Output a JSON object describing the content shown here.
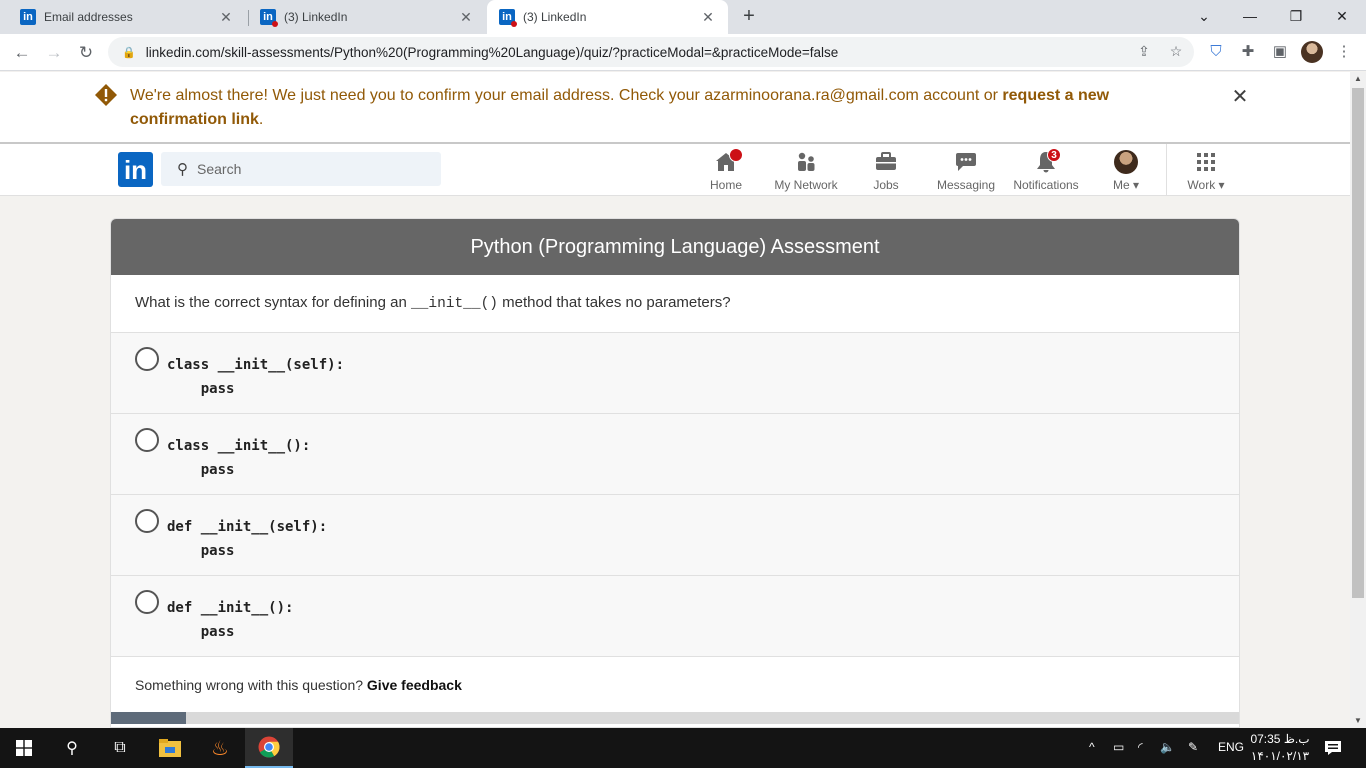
{
  "browser": {
    "tabs": [
      {
        "label": "Email addresses",
        "favicon": "linkedin-icon"
      },
      {
        "label": "(3) LinkedIn",
        "favicon": "linkedin-icon"
      },
      {
        "label": "(3) LinkedIn",
        "favicon": "linkedin-icon",
        "active": true
      }
    ],
    "url": "linkedin.com/skill-assessments/Python%20(Programming%20Language)/quiz/?practiceModal=&practiceMode=false"
  },
  "banner": {
    "message": "We're almost there! We just need you to confirm your email address. Check your azarminoorana.ra@gmail.com account or ",
    "link": "request a new confirmation link",
    "suffix": "."
  },
  "nav": {
    "logo": "in",
    "search_placeholder": "Search",
    "items": [
      {
        "label": "Home",
        "icon": "home-icon",
        "badge": ""
      },
      {
        "label": "My Network",
        "icon": "network-icon",
        "badge": ""
      },
      {
        "label": "Jobs",
        "icon": "briefcase-icon",
        "badge": ""
      },
      {
        "label": "Messaging",
        "icon": "chat-icon",
        "badge": ""
      },
      {
        "label": "Notifications",
        "icon": "bell-icon",
        "badge": "3"
      },
      {
        "label": "Me",
        "icon": "avatar",
        "badge": ""
      },
      {
        "label": "Work",
        "icon": "grid-icon",
        "badge": ""
      }
    ]
  },
  "assessment": {
    "title": "Python (Programming Language) Assessment",
    "question_prefix": "What is the correct syntax for defining an ",
    "question_code": "__init__()",
    "question_suffix": " method that takes no parameters?",
    "options": [
      "class __init__(self):\n    pass",
      "class __init__():\n    pass",
      "def __init__(self):\n    pass",
      "def __init__():\n    pass"
    ],
    "feedback_text": "Something wrong with this question? ",
    "feedback_link": "Give feedback",
    "progress": 0.066
  },
  "taskbar": {
    "language": "ENG",
    "time": "07:35 ب.ظ",
    "date": "۱۴۰۱/۰۲/۱۳"
  },
  "colors": {
    "linkedin_blue": "#0a66c2",
    "banner_text": "#915907",
    "header_gray": "#666666",
    "badge_red": "#cc1016"
  }
}
